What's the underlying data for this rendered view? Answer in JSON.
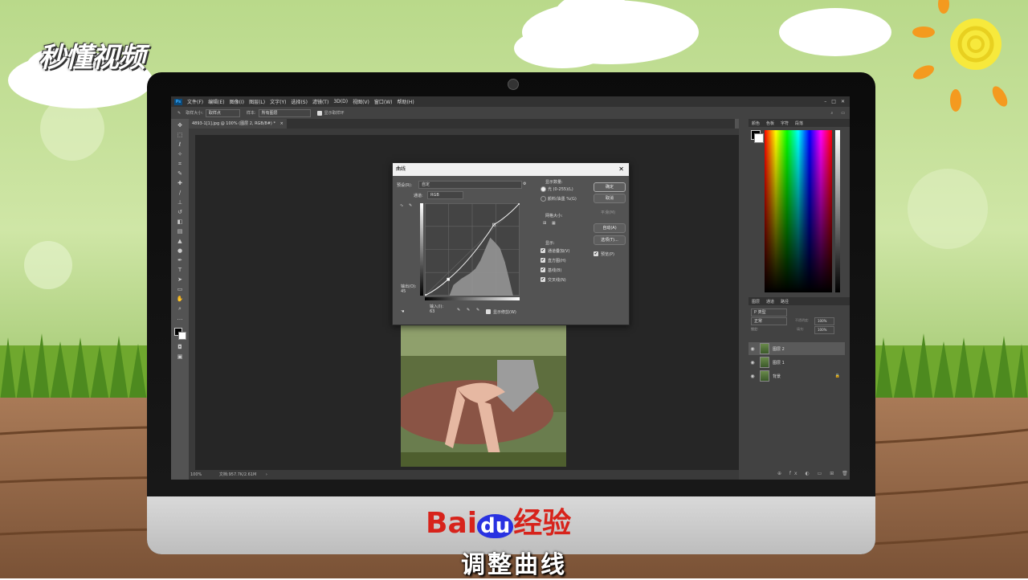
{
  "brand_logo": "秒懂视频",
  "watermark": {
    "baidu": "Bai",
    "du": "du",
    "jingyan": "经验",
    "caption": "调整曲线"
  },
  "ps": {
    "logo": "Ps",
    "menus": [
      "文件(F)",
      "编辑(E)",
      "图像(I)",
      "图层(L)",
      "文字(Y)",
      "选择(S)",
      "滤镜(T)",
      "3D(D)",
      "视图(V)",
      "窗口(W)",
      "帮助(H)"
    ],
    "options": {
      "brush_size": "取样大小:",
      "brush_val": "取样点",
      "sample": "样本:",
      "all_layers": "所有图层",
      "show_ring": "显示取样环"
    },
    "doc_tab": "4893-1[1].jpg @ 100% (图层 2, RGB/8#) *",
    "status": {
      "zoom": "100%",
      "doc": "文档:957.7K/2.61M"
    },
    "panel_tabs_top": [
      "颜色",
      "色板",
      "字符",
      "段落"
    ],
    "panel_tabs_layers": [
      "图层",
      "通道",
      "路径"
    ],
    "layers_kind": "P 类型",
    "layers_mode": "正常",
    "layers_opacity_label": "不透明度:",
    "layers_opacity": "100%",
    "layers_lock": "锁定:",
    "layers_fill_label": "填充:",
    "layers_fill": "100%",
    "layers": [
      {
        "name": "图层 2",
        "selected": true
      },
      {
        "name": "图层 1",
        "selected": false
      },
      {
        "name": "背景",
        "selected": false
      }
    ]
  },
  "curves": {
    "title": "曲线",
    "preset_label": "预设(R):",
    "preset_value": "自定",
    "channel_label": "通道:",
    "channel_value": "RGB",
    "output_label": "输出(O):",
    "output_value": "45",
    "input_label": "输入(I):",
    "input_value": "63",
    "show_clipping": "显示修剪(W)",
    "display_amount": "显示数量:",
    "light_option": "光 (0-255)(L)",
    "pigment_option": "颜料/油墨 %(G)",
    "grid_size": "网格大小:",
    "show_label": "显示:",
    "show_options": [
      "通道叠加(V)",
      "直方图(H)",
      "基线(B)",
      "交叉线(N)"
    ],
    "ok": "确定",
    "cancel": "取消",
    "smooth": "平滑(M)",
    "auto": "自动(A)",
    "options": "选项(T)...",
    "preview": "预览(P)",
    "curve_points": [
      [
        0,
        0
      ],
      [
        63,
        45
      ],
      [
        186,
        196
      ],
      [
        255,
        255
      ]
    ]
  },
  "colors": {
    "accent": "#d7231b",
    "ps_bg": "#535353",
    "dialog_bg": "#535353"
  }
}
